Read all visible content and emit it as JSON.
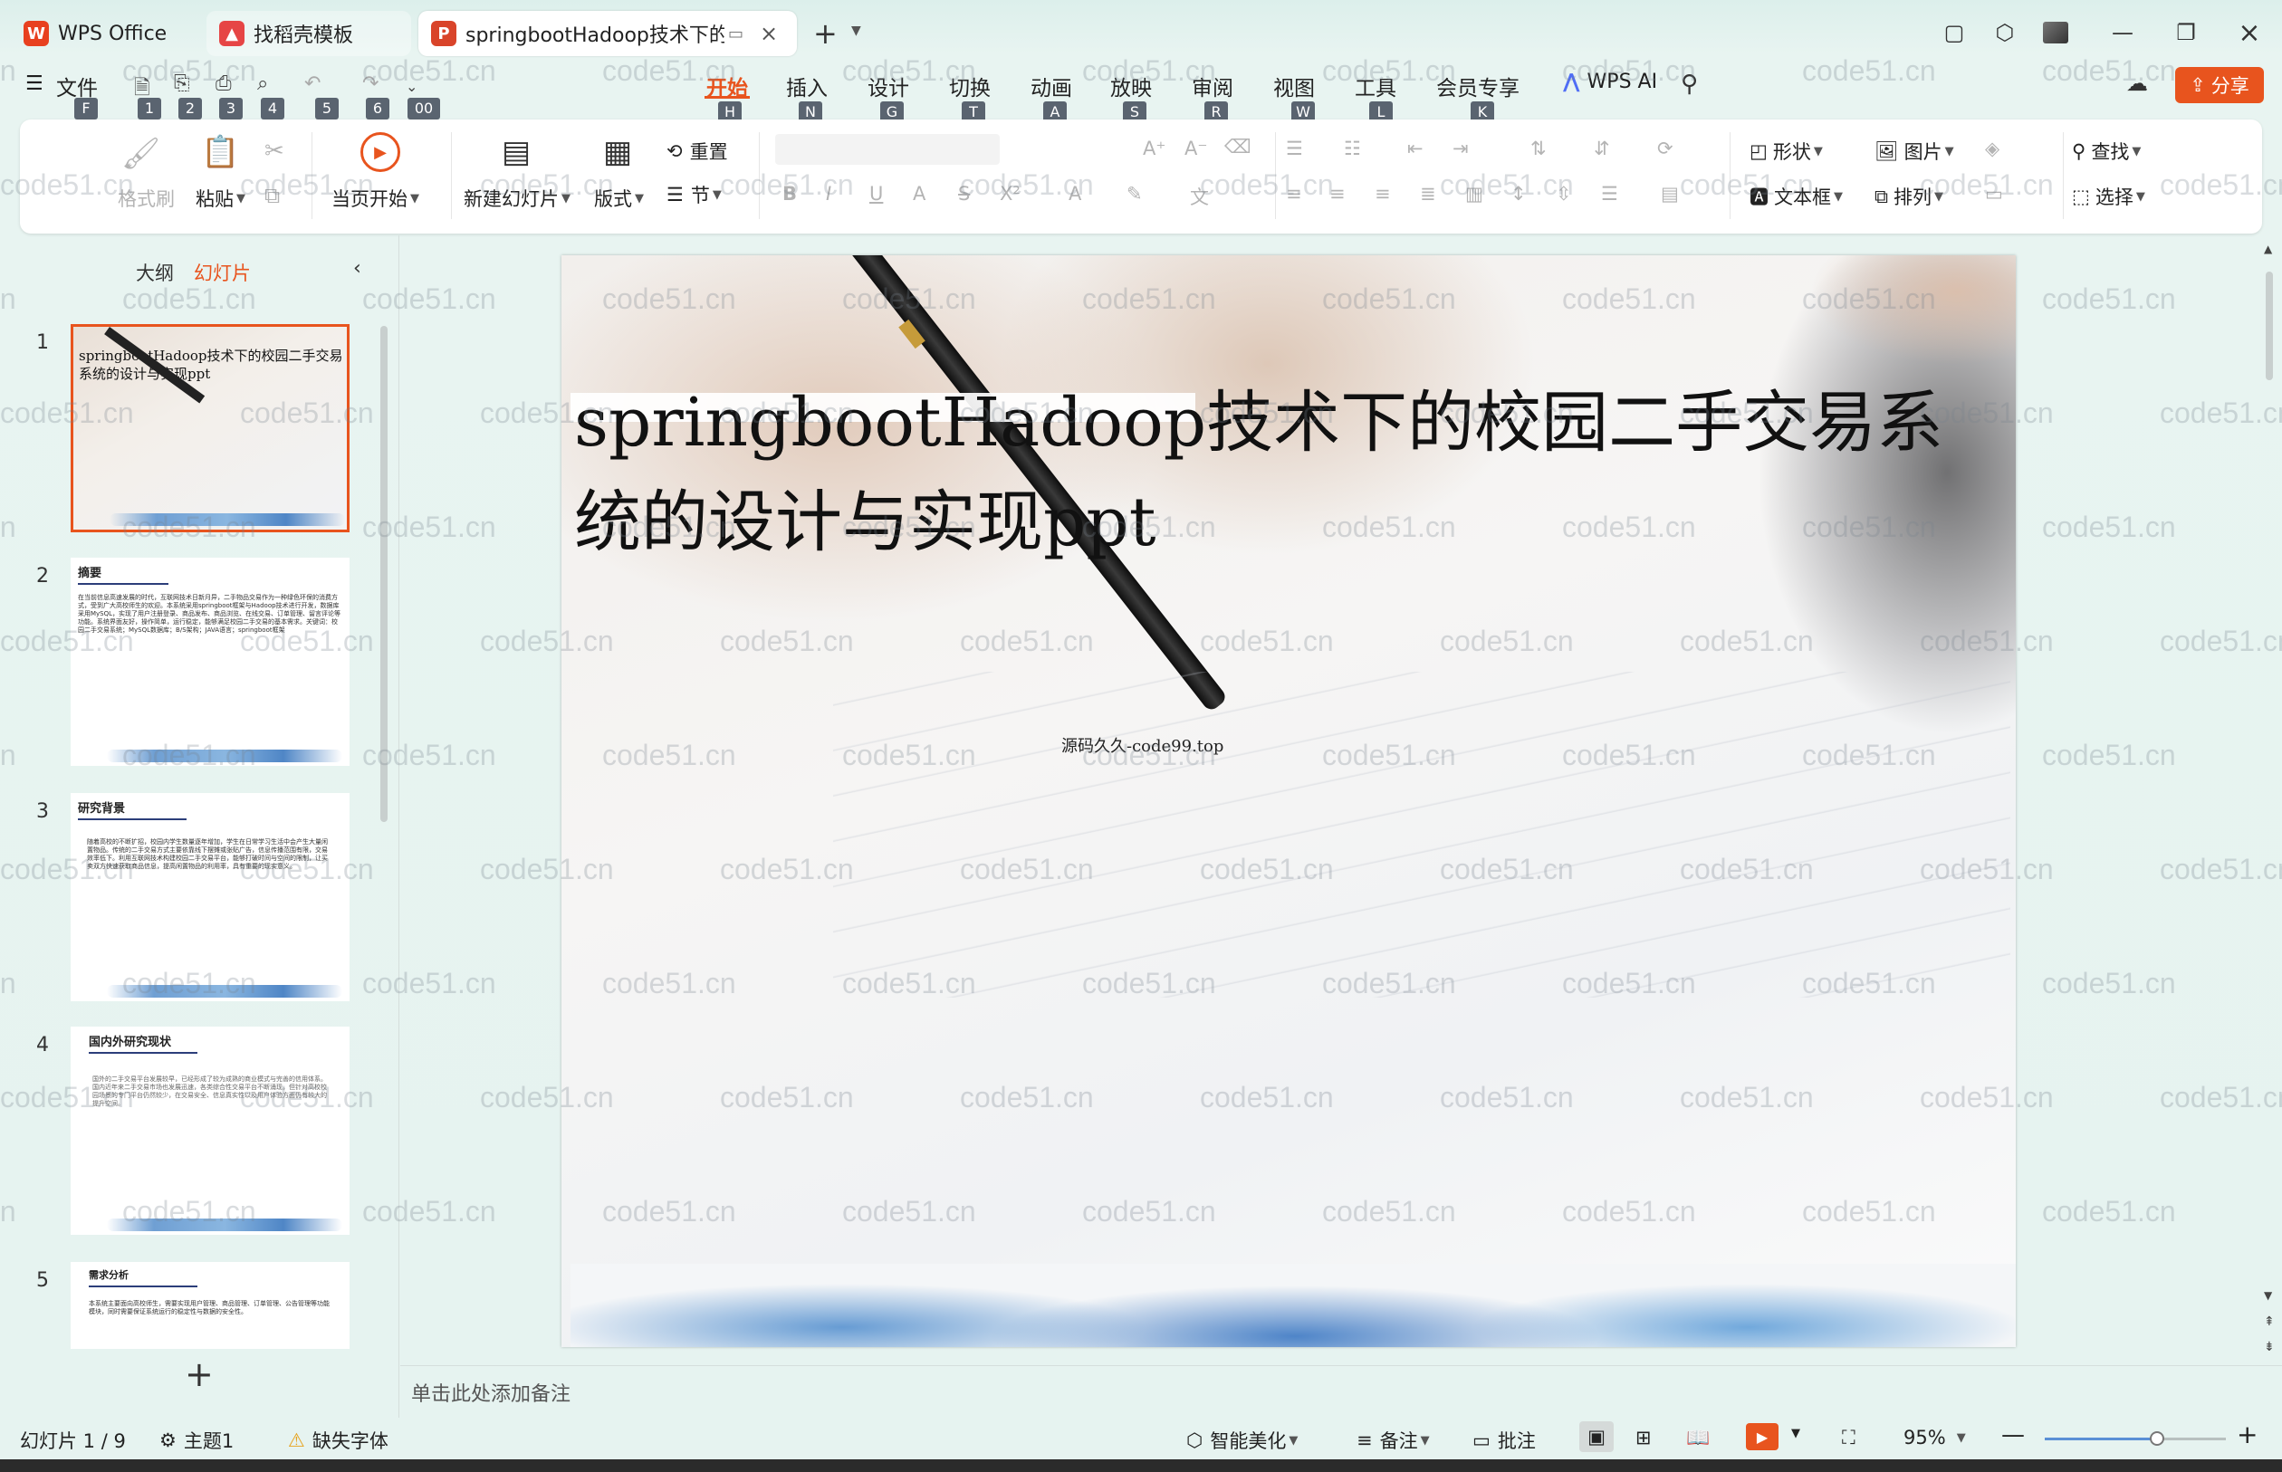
{
  "title_bar": {
    "tabs": [
      {
        "label": "WPS Office"
      },
      {
        "label": "找稻壳模板"
      },
      {
        "label": "springbootHadoop技术下的"
      }
    ]
  },
  "menu": {
    "items": [
      {
        "label": "文件",
        "key": "F"
      },
      {
        "label": "开始",
        "key": "H"
      },
      {
        "label": "插入",
        "key": "N"
      },
      {
        "label": "设计",
        "key": "G"
      },
      {
        "label": "切换",
        "key": "T"
      },
      {
        "label": "动画",
        "key": "A"
      },
      {
        "label": "放映",
        "key": "S"
      },
      {
        "label": "审阅",
        "key": "R"
      },
      {
        "label": "视图",
        "key": "W"
      },
      {
        "label": "工具",
        "key": "L"
      },
      {
        "label": "会员专享",
        "key": "K"
      }
    ],
    "quick_keys": [
      "1",
      "2",
      "3",
      "4",
      "5",
      "6",
      "00"
    ],
    "wps_ai": "WPS AI",
    "share": "分享"
  },
  "ribbon": {
    "format_painter": "格式刷",
    "paste": "粘贴",
    "play_current": "当页开始",
    "new_slide": "新建幻灯片",
    "layout": "版式",
    "reset": "重置",
    "section": "节",
    "shape": "形状",
    "picture": "图片",
    "textbox": "文本框",
    "arrange": "排列",
    "find": "查找",
    "select": "选择"
  },
  "panel": {
    "tab_outline": "大纲",
    "tab_slides": "幻灯片",
    "slides": [
      {
        "num": "1",
        "title": "springbootHadoop技术下的校园二手交易系统的设计与实现ppt"
      },
      {
        "num": "2",
        "title": "摘要",
        "body": "在当前信息高速发展的时代，互联网技术日新月异，二手物品交易作为一种绿色环保的消费方式，受到广大高校师生的欢迎。本系统采用springboot框架与Hadoop技术进行开发，数据库采用MySQL，实现了用户注册登录、商品发布、商品浏览、在线交易、订单管理、留言评论等功能。系统界面友好，操作简单，运行稳定，能够满足校园二手交易的基本需求。关键词：校园二手交易系统；MySQL数据库；B/S架构；JAVA语言；springboot框架"
      },
      {
        "num": "3",
        "title": "研究背景",
        "body": "随着高校的不断扩招，校园内学生数量逐年增加，学生在日常学习生活中会产生大量闲置物品。传统的二手交易方式主要依靠线下摆摊或张贴广告，信息传播范围有限，交易效率低下。利用互联网技术构建校园二手交易平台，能够打破时间与空间的限制，让买卖双方快速获取商品信息，提高闲置物品的利用率，具有重要的现实意义。"
      },
      {
        "num": "4",
        "title": "国内外研究现状",
        "body": "国外的二手交易平台发展较早，已经形成了较为成熟的商业模式与完善的信用体系。国内近年来二手交易市场也发展迅速，各类综合性交易平台不断涌现，但针对高校校园场景的专门平台仍然较少，在交易安全、信息真实性以及用户体验方面仍有较大的提升空间。"
      },
      {
        "num": "5",
        "title": "需求分析",
        "body": "本系统主要面向高校师生，需要实现用户管理、商品管理、订单管理、公告管理等功能模块，同时需要保证系统运行的稳定性与数据的安全性。"
      }
    ],
    "add": "+"
  },
  "slide": {
    "title": "springbootHadoop技术下的校园二手交易系统的设计与实现ppt",
    "subtitle": "源码久久-code99.top"
  },
  "notes_placeholder": "单击此处添加备注",
  "status": {
    "slide_counter": "幻灯片 1 / 9",
    "theme": "主题1",
    "missing_font": "缺失字体",
    "smart_beautify": "智能美化",
    "notes": "备注",
    "comments": "批注",
    "zoom": "95%",
    "zoom_fraction": 0.62
  },
  "watermark": "code51.cn",
  "colors": {
    "accent": "#e8541e",
    "bg": "#e4f2ef"
  }
}
